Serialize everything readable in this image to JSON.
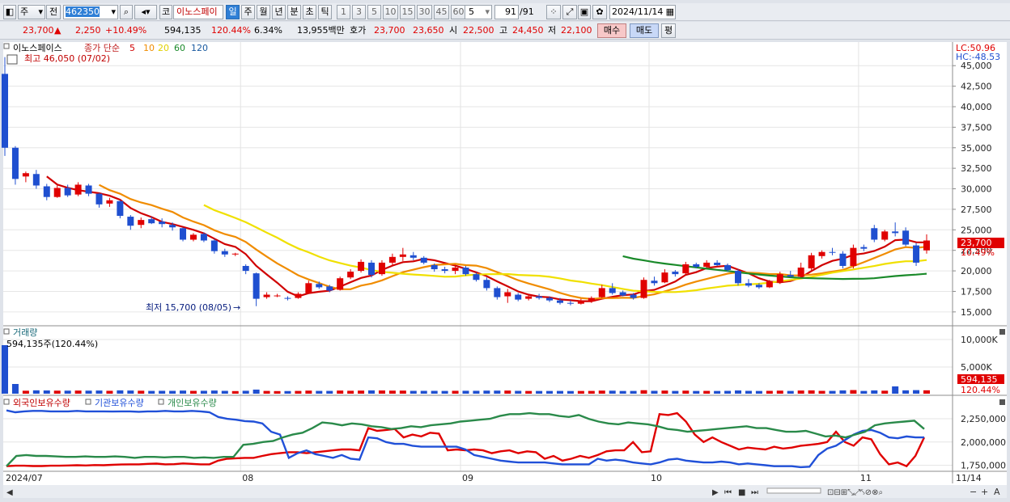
{
  "toolbar": {
    "market": "주",
    "prev": "전",
    "code": "462350",
    "kind": "코",
    "name": "이노스페이",
    "periods": [
      "일",
      "주",
      "월",
      "년",
      "분",
      "초",
      "틱"
    ],
    "active_period": "일",
    "intervals": [
      "1",
      "3",
      "5",
      "10",
      "15",
      "30",
      "45",
      "60"
    ],
    "interval_value": "5",
    "count_display": "91",
    "count_total": "/91",
    "date": "2024/11/14"
  },
  "quote": {
    "price": "23,700",
    "arrow": "▲",
    "change": "2,250",
    "change_pct": "+10.49%",
    "volume": "594,135",
    "volume_ratio": "120.44%",
    "turnover": "6.34%",
    "trade_value": "13,955백만",
    "bidask_label": "호가",
    "ask": "23,700",
    "bid": "23,650",
    "open_label": "시",
    "open": "22,500",
    "high_label": "고",
    "high": "24,450",
    "low_label": "저",
    "low": "22,100",
    "buy_btn": "매수",
    "sell_btn": "매도",
    "eval_btn": "평"
  },
  "price_panel": {
    "legend_name": "이노스페이스",
    "legend_ma": "종가 단순",
    "ma_periods": [
      "5",
      "10",
      "20",
      "60",
      "120"
    ],
    "max_label": "최고 46,050 (07/02)",
    "min_label": "최저 15,700 (08/05)",
    "lc": "LC:50.96",
    "hc": "HC:-48.53",
    "last_price_tag": "23,700",
    "last_pct_tag": "10.49%",
    "y_ticks": [
      "45,000",
      "42,500",
      "40,000",
      "37,500",
      "35,000",
      "32,500",
      "30,000",
      "27,500",
      "25,000",
      "22,500",
      "20,000",
      "17,500",
      "15,000"
    ]
  },
  "volume_panel": {
    "title": "거래량",
    "value_label": "594,135주(120.44%)",
    "y_ticks": [
      "10,000K",
      "5,000K"
    ],
    "tag_value": "594,135",
    "tag_pct": "120.44%"
  },
  "holding_panel": {
    "legend": [
      "외국인보유수량",
      "기관보유수량",
      "개인보유수량"
    ],
    "y_ticks": [
      "2,250,000",
      "2,000,000",
      "1,750,000"
    ]
  },
  "x_axis": {
    "labels": [
      "2024/07",
      "08",
      "09",
      "10",
      "11",
      "11/14"
    ]
  },
  "colors": {
    "up": "#e00000",
    "down": "#1f4fd0",
    "ma5": "#d00000",
    "ma10": "#f08c00",
    "ma20": "#f0e000",
    "ma60": "#1a8a2a",
    "foreign": "#e00000",
    "inst": "#2050d8",
    "retail": "#2a8a4a",
    "accent": "#2f7fd6"
  },
  "chart_data": [
    {
      "type": "candlestick",
      "title": "이노스페이스",
      "y_range": [
        14000,
        46500
      ],
      "x_labels": [
        "2024/07",
        "08",
        "09",
        "10",
        "11"
      ],
      "candles": [
        {
          "o": 44000,
          "h": 46050,
          "l": 34000,
          "c": 35000
        },
        {
          "o": 35000,
          "h": 35200,
          "l": 30500,
          "c": 31200
        },
        {
          "o": 31500,
          "h": 32100,
          "l": 30800,
          "c": 31900
        },
        {
          "o": 31800,
          "h": 32300,
          "l": 30000,
          "c": 30400
        },
        {
          "o": 30300,
          "h": 30600,
          "l": 28600,
          "c": 29000
        },
        {
          "o": 29000,
          "h": 30400,
          "l": 28900,
          "c": 30100
        },
        {
          "o": 30100,
          "h": 30500,
          "l": 29000,
          "c": 29200
        },
        {
          "o": 29300,
          "h": 30800,
          "l": 29100,
          "c": 30500
        },
        {
          "o": 30400,
          "h": 30600,
          "l": 29100,
          "c": 29400
        },
        {
          "o": 29400,
          "h": 29500,
          "l": 27700,
          "c": 28100
        },
        {
          "o": 28200,
          "h": 28900,
          "l": 27800,
          "c": 28600
        },
        {
          "o": 28500,
          "h": 28600,
          "l": 26400,
          "c": 26700
        },
        {
          "o": 26600,
          "h": 26800,
          "l": 25000,
          "c": 25500
        },
        {
          "o": 25600,
          "h": 26500,
          "l": 25200,
          "c": 26200
        },
        {
          "o": 26300,
          "h": 26600,
          "l": 25700,
          "c": 25800
        },
        {
          "o": 26000,
          "h": 26400,
          "l": 25300,
          "c": 25700
        },
        {
          "o": 25600,
          "h": 25900,
          "l": 24900,
          "c": 25300
        },
        {
          "o": 25200,
          "h": 25300,
          "l": 23600,
          "c": 23800
        },
        {
          "o": 23800,
          "h": 24600,
          "l": 23600,
          "c": 24400
        },
        {
          "o": 24500,
          "h": 24700,
          "l": 23500,
          "c": 23700
        },
        {
          "o": 23700,
          "h": 23900,
          "l": 22100,
          "c": 22400
        },
        {
          "o": 22400,
          "h": 22700,
          "l": 21700,
          "c": 22000
        },
        {
          "o": 22000,
          "h": 22200,
          "l": 21800,
          "c": 22100
        },
        {
          "o": 20600,
          "h": 20800,
          "l": 19600,
          "c": 20000
        },
        {
          "o": 19700,
          "h": 19800,
          "l": 15700,
          "c": 16600
        },
        {
          "o": 16800,
          "h": 17400,
          "l": 16600,
          "c": 17100
        },
        {
          "o": 17000,
          "h": 17200,
          "l": 16800,
          "c": 17000
        },
        {
          "o": 16700,
          "h": 16900,
          "l": 16400,
          "c": 16600
        },
        {
          "o": 16700,
          "h": 17400,
          "l": 16600,
          "c": 17200
        },
        {
          "o": 17300,
          "h": 18800,
          "l": 17200,
          "c": 18500
        },
        {
          "o": 18400,
          "h": 18700,
          "l": 17800,
          "c": 18000
        },
        {
          "o": 18100,
          "h": 18300,
          "l": 17400,
          "c": 17600
        },
        {
          "o": 17700,
          "h": 19300,
          "l": 17600,
          "c": 19100
        },
        {
          "o": 19200,
          "h": 20200,
          "l": 19000,
          "c": 19900
        },
        {
          "o": 20000,
          "h": 21400,
          "l": 19800,
          "c": 21100
        },
        {
          "o": 21000,
          "h": 21300,
          "l": 19200,
          "c": 19500
        },
        {
          "o": 19600,
          "h": 21300,
          "l": 19400,
          "c": 21000
        },
        {
          "o": 21000,
          "h": 22100,
          "l": 20600,
          "c": 21700
        },
        {
          "o": 21700,
          "h": 22800,
          "l": 21200,
          "c": 22000
        },
        {
          "o": 21900,
          "h": 22300,
          "l": 21300,
          "c": 21600
        },
        {
          "o": 21600,
          "h": 21800,
          "l": 20800,
          "c": 21000
        },
        {
          "o": 20700,
          "h": 20900,
          "l": 19900,
          "c": 20200
        },
        {
          "o": 20200,
          "h": 20500,
          "l": 19700,
          "c": 20000
        },
        {
          "o": 20000,
          "h": 20700,
          "l": 19600,
          "c": 20400
        },
        {
          "o": 20400,
          "h": 20600,
          "l": 19400,
          "c": 19600
        },
        {
          "o": 19600,
          "h": 19800,
          "l": 18700,
          "c": 18900
        },
        {
          "o": 18900,
          "h": 19200,
          "l": 17600,
          "c": 17900
        },
        {
          "o": 17900,
          "h": 18100,
          "l": 16500,
          "c": 16800
        },
        {
          "o": 16900,
          "h": 17800,
          "l": 16100,
          "c": 17400
        },
        {
          "o": 17100,
          "h": 17300,
          "l": 16300,
          "c": 16500
        },
        {
          "o": 16600,
          "h": 17100,
          "l": 16400,
          "c": 16900
        },
        {
          "o": 16900,
          "h": 17200,
          "l": 16500,
          "c": 16700
        },
        {
          "o": 16700,
          "h": 16900,
          "l": 16200,
          "c": 16400
        },
        {
          "o": 16400,
          "h": 16700,
          "l": 15900,
          "c": 16100
        },
        {
          "o": 16100,
          "h": 16400,
          "l": 15800,
          "c": 16000
        },
        {
          "o": 16000,
          "h": 16600,
          "l": 15900,
          "c": 16300
        },
        {
          "o": 16300,
          "h": 16900,
          "l": 16100,
          "c": 16700
        },
        {
          "o": 16800,
          "h": 18300,
          "l": 16700,
          "c": 17900
        },
        {
          "o": 17900,
          "h": 18500,
          "l": 17100,
          "c": 17300
        },
        {
          "o": 17400,
          "h": 17600,
          "l": 16900,
          "c": 17000
        },
        {
          "o": 17100,
          "h": 17300,
          "l": 16500,
          "c": 16700
        },
        {
          "o": 16700,
          "h": 19200,
          "l": 16600,
          "c": 18900
        },
        {
          "o": 18800,
          "h": 19300,
          "l": 18200,
          "c": 18500
        },
        {
          "o": 18600,
          "h": 20200,
          "l": 18500,
          "c": 19800
        },
        {
          "o": 19900,
          "h": 20100,
          "l": 19300,
          "c": 19600
        },
        {
          "o": 19700,
          "h": 21100,
          "l": 19600,
          "c": 20800
        },
        {
          "o": 20800,
          "h": 21000,
          "l": 20300,
          "c": 20500
        },
        {
          "o": 20500,
          "h": 21300,
          "l": 20400,
          "c": 21000
        },
        {
          "o": 21000,
          "h": 21300,
          "l": 20600,
          "c": 20700
        },
        {
          "o": 20700,
          "h": 20900,
          "l": 19900,
          "c": 20100
        },
        {
          "o": 20000,
          "h": 20200,
          "l": 18200,
          "c": 18500
        },
        {
          "o": 18500,
          "h": 19000,
          "l": 18000,
          "c": 18200
        },
        {
          "o": 18300,
          "h": 18500,
          "l": 17800,
          "c": 18000
        },
        {
          "o": 18000,
          "h": 18900,
          "l": 17900,
          "c": 18700
        },
        {
          "o": 18600,
          "h": 19900,
          "l": 18400,
          "c": 19600
        },
        {
          "o": 19500,
          "h": 20000,
          "l": 19200,
          "c": 19300
        },
        {
          "o": 19300,
          "h": 21000,
          "l": 19200,
          "c": 20400
        },
        {
          "o": 20300,
          "h": 22200,
          "l": 20100,
          "c": 21900
        },
        {
          "o": 21800,
          "h": 22500,
          "l": 21500,
          "c": 22300
        },
        {
          "o": 22300,
          "h": 22800,
          "l": 21900,
          "c": 22200
        },
        {
          "o": 22100,
          "h": 22400,
          "l": 20300,
          "c": 20600
        },
        {
          "o": 20600,
          "h": 23200,
          "l": 20300,
          "c": 22800
        },
        {
          "o": 22900,
          "h": 23200,
          "l": 22400,
          "c": 22700
        },
        {
          "o": 25200,
          "h": 25600,
          "l": 23500,
          "c": 23800
        },
        {
          "o": 23800,
          "h": 25000,
          "l": 23600,
          "c": 24800
        },
        {
          "o": 24800,
          "h": 25900,
          "l": 24200,
          "c": 24600
        },
        {
          "o": 24900,
          "h": 25300,
          "l": 23000,
          "c": 23200
        },
        {
          "o": 23100,
          "h": 23400,
          "l": 20600,
          "c": 21000
        },
        {
          "o": 22500,
          "h": 24450,
          "l": 22100,
          "c": 23700
        }
      ]
    },
    {
      "type": "line",
      "title": "외국인보유수량 / 기관보유수량 / 개인보유수량",
      "y_range": [
        1720000,
        2320000
      ],
      "series": [
        {
          "name": "외국인보유수량",
          "values": [
            1740000,
            1745000,
            1745000,
            1742000,
            1742000,
            1745000,
            1745000,
            1748000,
            1750000,
            1748000,
            1752000,
            1750000,
            1755000,
            1758000,
            1760000,
            1760000,
            1765000,
            1768000,
            1760000,
            1762000,
            1770000,
            1765000,
            1760000,
            1760000,
            1800000,
            1820000,
            1825000,
            1830000,
            1830000,
            1850000,
            1870000,
            1880000,
            1890000,
            1890000,
            1880000,
            1890000,
            1900000,
            1910000,
            1920000,
            1920000,
            1910000,
            2150000,
            2120000,
            2130000,
            2140000,
            2050000,
            2080000,
            2060000,
            2100000,
            2090000,
            1910000,
            1920000,
            1910000,
            1920000,
            1910000,
            1880000,
            1900000,
            1910000,
            1880000,
            1900000,
            1890000,
            1820000,
            1850000,
            1800000,
            1820000,
            1850000,
            1830000,
            1860000,
            1900000,
            1910000,
            1910000,
            2000000,
            1890000,
            1900000,
            2300000,
            2290000,
            2310000,
            2220000,
            2080000,
            2000000,
            2050000,
            2000000,
            1960000,
            1920000,
            1940000,
            1930000,
            1920000,
            1950000,
            1930000,
            1940000,
            1960000,
            1970000,
            1980000,
            2000000,
            2110000,
            2000000,
            1960000,
            2050000,
            2030000,
            1870000,
            1760000,
            1780000,
            1740000,
            1850000,
            2050000
          ]
        },
        {
          "name": "기관보유수량",
          "values": [
            2340000,
            2320000,
            2330000,
            2335000,
            2335000,
            2330000,
            2330000,
            2330000,
            2335000,
            2330000,
            2330000,
            2330000,
            2328000,
            2330000,
            2330000,
            2325000,
            2330000,
            2330000,
            2335000,
            2330000,
            2330000,
            2335000,
            2330000,
            2320000,
            2270000,
            2250000,
            2240000,
            2225000,
            2220000,
            2200000,
            2110000,
            2080000,
            1830000,
            1880000,
            1910000,
            1870000,
            1850000,
            1830000,
            1860000,
            1820000,
            1810000,
            2050000,
            2040000,
            2000000,
            1980000,
            1980000,
            1960000,
            1950000,
            1950000,
            1950000,
            1950000,
            1950000,
            1920000,
            1860000,
            1840000,
            1820000,
            1800000,
            1790000,
            1780000,
            1780000,
            1780000,
            1780000,
            1770000,
            1760000,
            1760000,
            1760000,
            1760000,
            1820000,
            1800000,
            1810000,
            1800000,
            1780000,
            1770000,
            1760000,
            1780000,
            1810000,
            1820000,
            1800000,
            1790000,
            1780000,
            1780000,
            1790000,
            1780000,
            1760000,
            1770000,
            1760000,
            1750000,
            1740000,
            1740000,
            1740000,
            1730000,
            1735000,
            1860000,
            1930000,
            1960000,
            2020000,
            2080000,
            2120000,
            2130000,
            2100000,
            2050000,
            2040000,
            2060000,
            2050000,
            2050000
          ]
        },
        {
          "name": "개인보유수량",
          "values": [
            1740000,
            1850000,
            1860000,
            1850000,
            1850000,
            1845000,
            1840000,
            1840000,
            1845000,
            1840000,
            1840000,
            1845000,
            1840000,
            1830000,
            1840000,
            1840000,
            1835000,
            1840000,
            1840000,
            1830000,
            1835000,
            1830000,
            1840000,
            1840000,
            1970000,
            1980000,
            2000000,
            2010000,
            2050000,
            2080000,
            2100000,
            2150000,
            2210000,
            2200000,
            2180000,
            2200000,
            2190000,
            2170000,
            2160000,
            2140000,
            2150000,
            2170000,
            2160000,
            2180000,
            2190000,
            2200000,
            2220000,
            2230000,
            2240000,
            2250000,
            2280000,
            2300000,
            2300000,
            2310000,
            2300000,
            2300000,
            2280000,
            2270000,
            2290000,
            2250000,
            2220000,
            2200000,
            2190000,
            2210000,
            2200000,
            2190000,
            2170000,
            2140000,
            2130000,
            2110000,
            2120000,
            2130000,
            2140000,
            2150000,
            2160000,
            2170000,
            2150000,
            2150000,
            2130000,
            2110000,
            2110000,
            2120000,
            2090000,
            2060000,
            2070000,
            2050000,
            2080000,
            2110000,
            2180000,
            2200000,
            2210000,
            2220000,
            2230000,
            2140000
          ]
        }
      ]
    }
  ]
}
